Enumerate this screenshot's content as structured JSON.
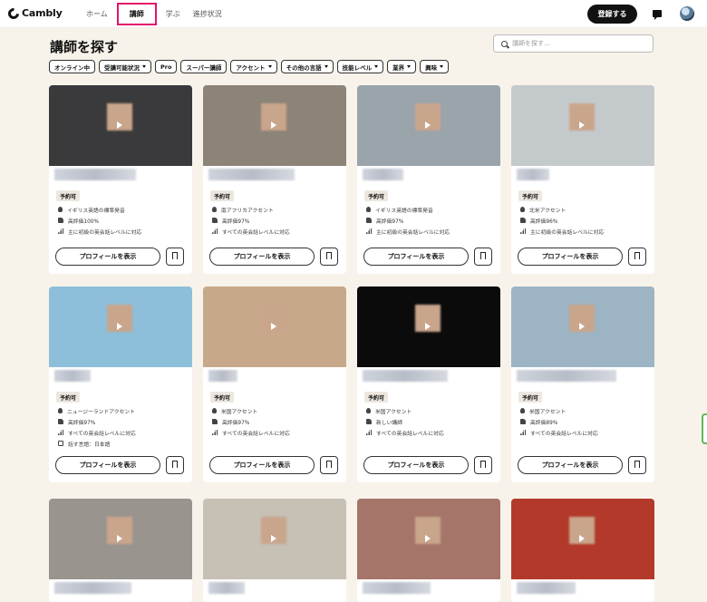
{
  "header": {
    "logo": "Cambly",
    "nav": [
      "ホーム",
      "講師",
      "学ぶ",
      "進捗状況"
    ],
    "active_nav": "講師",
    "signup": "登録する"
  },
  "page": {
    "title": "講師を探す",
    "search_placeholder": "講師を探す..."
  },
  "filters": [
    {
      "label": "オンライン中",
      "dropdown": false
    },
    {
      "label": "受講可能状況",
      "dropdown": true
    },
    {
      "label": "Pro",
      "dropdown": false
    },
    {
      "label": "スーパー講師",
      "dropdown": false
    },
    {
      "label": "アクセント",
      "dropdown": true
    },
    {
      "label": "その他の言語",
      "dropdown": true
    },
    {
      "label": "技能レベル",
      "dropdown": true
    },
    {
      "label": "業界",
      "dropdown": true
    },
    {
      "label": "興味",
      "dropdown": true
    }
  ],
  "cards": [
    {
      "badge": "予約可",
      "features": [
        "イギリス英語の標準発音",
        "高評価100%",
        "主に初級の英会話レベルに対応"
      ],
      "bg": "#3a3a3c",
      "profile": "プロフィールを表示"
    },
    {
      "badge": "予約可",
      "features": [
        "南アフリカアクセント",
        "高評価97%",
        "すべての英会話レベルに対応"
      ],
      "bg": "#8c8478",
      "profile": "プロフィールを表示"
    },
    {
      "badge": "予約可",
      "features": [
        "イギリス英語の標準発音",
        "高評価97%",
        "主に初級の英会話レベルに対応"
      ],
      "bg": "#9aa4ab",
      "profile": "プロフィールを表示"
    },
    {
      "badge": "予約可",
      "features": [
        "北米アクセント",
        "高評価96%",
        "主に初級の英会話レベルに対応"
      ],
      "bg": "#c4cacc",
      "profile": "プロフィールを表示"
    },
    {
      "badge": "予約可",
      "features": [
        "ニュージーランドアクセント",
        "高評価97%",
        "すべての英会話レベルに対応",
        "話す言語：日本語"
      ],
      "bg": "#8dbfda",
      "profile": "プロフィールを表示"
    },
    {
      "badge": "予約可",
      "features": [
        "米国アクセント",
        "高評価97%",
        "すべての英会話レベルに対応"
      ],
      "bg": "#c8a88a",
      "profile": "プロフィールを表示"
    },
    {
      "badge": "予約可",
      "features": [
        "米国アクセント",
        "新しい講師",
        "すべての英会話レベルに対応"
      ],
      "bg": "#0b0b0b",
      "profile": "プロフィールを表示"
    },
    {
      "badge": "予約可",
      "features": [
        "米国アクセント",
        "高評価89%",
        "すべての英会話レベルに対応"
      ],
      "bg": "#9db4c4",
      "profile": "プロフィールを表示"
    },
    {
      "bg": "#9a948e"
    },
    {
      "bg": "#c6c0b5"
    },
    {
      "bg": "#a5756a"
    },
    {
      "bg": "#b33a2b"
    }
  ]
}
